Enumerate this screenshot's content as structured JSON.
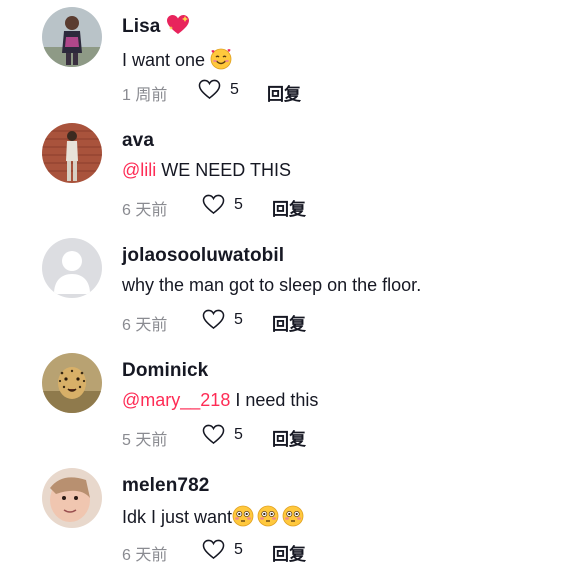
{
  "comments": [
    {
      "username": "Lisa",
      "username_emoji": "sparkling-heart",
      "mention": "",
      "text": "I want one ",
      "text_emojis": [
        "smiling-face-with-hearts"
      ],
      "time": "1 周前",
      "likes": "5",
      "reply_label": "回复"
    },
    {
      "username": "ava",
      "mention": "@lili",
      "text": " WE NEED THIS",
      "text_emojis": [],
      "time": "6 天前",
      "likes": "5",
      "reply_label": "回复"
    },
    {
      "username": "jolaosooluwatobil",
      "mention": "",
      "text": "why the man got to sleep on the floor.",
      "text_emojis": [],
      "time": "6 天前",
      "likes": "5",
      "reply_label": "回复"
    },
    {
      "username": "Dominick",
      "mention": "@mary__218",
      "text": " I need this",
      "text_emojis": [],
      "time": "5 天前",
      "likes": "5",
      "reply_label": "回复"
    },
    {
      "username": "melen782",
      "mention": "",
      "text": "Idk I just want",
      "text_emojis": [
        "flushed-face",
        "flushed-face",
        "flushed-face"
      ],
      "time": "6 天前",
      "likes": "5",
      "reply_label": "回复"
    }
  ],
  "colors": {
    "mention": "#fe2c55",
    "meta_text": "#8a8b91",
    "primary_text": "#161823"
  }
}
